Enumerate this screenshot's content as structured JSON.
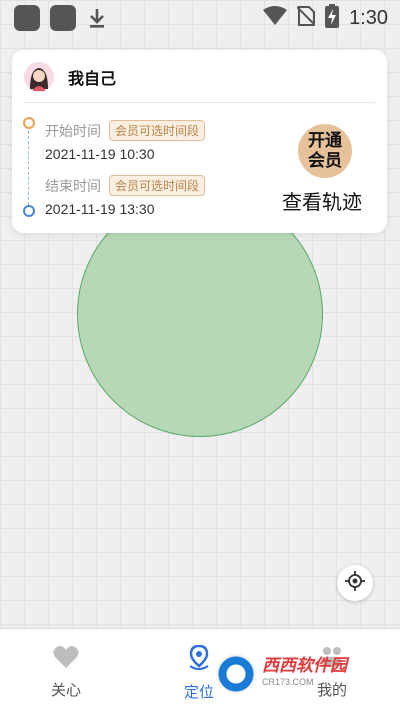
{
  "status_bar": {
    "time": "1:30",
    "icons": [
      "app-square-icon",
      "app-square-icon",
      "download-icon",
      "wifi-icon",
      "no-sim-icon",
      "battery-charging-icon"
    ]
  },
  "card": {
    "user_name": "我自己",
    "start_label": "开始时间",
    "start_tag": "会员可选时间段",
    "start_value": "2021-11-19 10:30",
    "end_label": "结束时间",
    "end_tag": "会员可选时间段",
    "end_value": "2021-11-19 13:30",
    "vip_line1": "开通",
    "vip_line2": "会员",
    "track_button": "查看轨迹"
  },
  "map": {
    "geofence_color": "#b6d8b6",
    "locate_icon": "crosshair-icon"
  },
  "bottom_nav": {
    "items": [
      {
        "label": "关心",
        "icon": "heart-icon",
        "active": false
      },
      {
        "label": "定位",
        "icon": "location-pin-icon",
        "active": true
      },
      {
        "label": "我的",
        "icon": "profile-icon",
        "active": false
      }
    ]
  },
  "watermark": {
    "main": "西西软件园",
    "sub": "CR173.COM"
  },
  "colors": {
    "accent": "#2f6fe0",
    "tag_text": "#b9834a",
    "vip_badge": "#e6c19a"
  }
}
